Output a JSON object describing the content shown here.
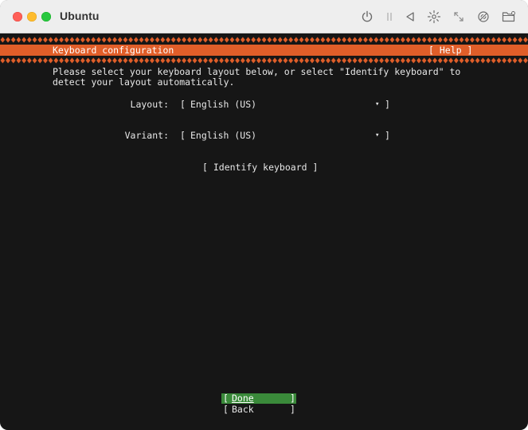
{
  "window": {
    "title": "Ubuntu",
    "toolbar_icons": [
      "power-icon",
      "pause-icon",
      "back-icon",
      "brightness-icon",
      "resize-icon",
      "network-icon",
      "folder-icon"
    ]
  },
  "installer": {
    "header": {
      "title": "Keyboard configuration",
      "help": "[ Help ]"
    },
    "intro_lines": [
      "Please select your keyboard layout below, or select \"Identify keyboard\" to",
      "detect your layout automatically."
    ],
    "layout": {
      "label": "Layout:",
      "open": "[",
      "value": "English (US)",
      "close": "]"
    },
    "variant": {
      "label": "Variant:",
      "open": "[",
      "value": "English (US)",
      "close": "]"
    },
    "identify_button": "[ Identify keyboard ]",
    "buttons": {
      "done_open": "[",
      "done_label": "Done",
      "done_close": "]",
      "back_open": "[",
      "back_label": "Back",
      "back_close": "]"
    }
  },
  "colors": {
    "accent": "#e05e29",
    "terminal_bg": "#161616",
    "selected_button": "#3a8a3a"
  }
}
